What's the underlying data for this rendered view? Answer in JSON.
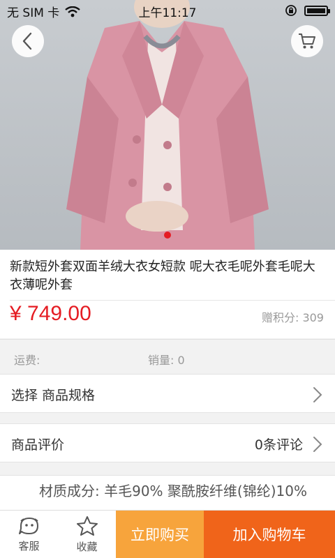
{
  "status": {
    "carrier": "无 SIM 卡",
    "time": "上午11:17"
  },
  "product": {
    "title": "新款短外套双面羊绒大衣女短款 呢大衣毛呢外套毛呢大衣薄呢外套",
    "price": "¥ 749.00",
    "points": "赠积分: 309",
    "shipping": "运费:",
    "sales": "销量: 0",
    "description": "材质成分: 羊毛90% 聚酰胺纤维(锦纶)10%"
  },
  "image_carousel": {
    "count": 1,
    "active": 0
  },
  "rows": {
    "spec_label": "选择 商品规格",
    "review_label": "商品评价",
    "review_count": "0条评论"
  },
  "bottom_bar": {
    "service_label": "客服",
    "favorite_label": "收藏",
    "buy_now_label": "立即购买",
    "add_to_cart_label": "加入购物车"
  },
  "colors": {
    "accent_red": "#e51c23",
    "buy_orange": "#f7a43c",
    "cart_orange": "#f0641a"
  },
  "icons": [
    "back-icon",
    "cart-icon",
    "wifi-icon",
    "lock-rotation-icon",
    "battery-icon",
    "chevron-right-icon",
    "service-face-icon",
    "star-icon"
  ]
}
